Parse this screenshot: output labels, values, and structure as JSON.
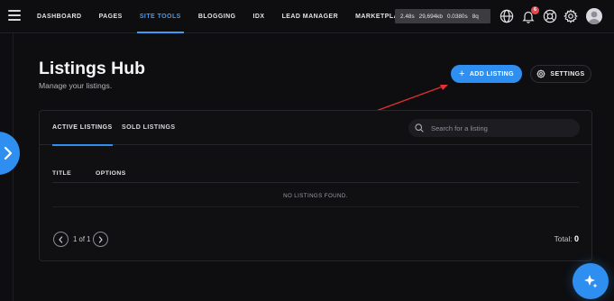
{
  "nav": {
    "items": [
      {
        "label": "DASHBOARD",
        "active": false
      },
      {
        "label": "PAGES",
        "active": false
      },
      {
        "label": "SITE TOOLS",
        "active": true
      },
      {
        "label": "BLOGGING",
        "active": false
      },
      {
        "label": "IDX",
        "active": false
      },
      {
        "label": "LEAD MANAGER",
        "active": false
      },
      {
        "label": "MARKETPLACE",
        "active": false
      }
    ]
  },
  "perf": {
    "t1": "2.48s",
    "mem": "29,694kb",
    "t2": "0.0380s",
    "q": "8q"
  },
  "notifications": {
    "count": "6"
  },
  "icons": {
    "menu": "hamburger-icon",
    "globe": "globe-icon",
    "bell": "bell-icon",
    "help": "lifebuoy-icon",
    "gear": "gear-icon",
    "avatar": "user-avatar",
    "sparkle": "sparkle-icon"
  },
  "header": {
    "title": "Listings Hub",
    "subtitle": "Manage your listings.",
    "add_label": "ADD LISTING",
    "settings_label": "SETTINGS"
  },
  "tabs": [
    {
      "label": "ACTIVE LISTINGS",
      "active": true
    },
    {
      "label": "SOLD LISTINGS",
      "active": false
    }
  ],
  "search": {
    "placeholder": "Search for a listing"
  },
  "table": {
    "columns": [
      "TITLE",
      "OPTIONS"
    ],
    "empty_message": "NO LISTINGS FOUND."
  },
  "pagination": {
    "label": "1 of 1"
  },
  "total": {
    "label": "Total:",
    "value": "0"
  },
  "colors": {
    "accent": "#2f8ff0",
    "nav_active": "#3d9cf5",
    "background": "#0e0e10",
    "badge": "#e5484d",
    "annotation_arrow": "#e0322f"
  }
}
